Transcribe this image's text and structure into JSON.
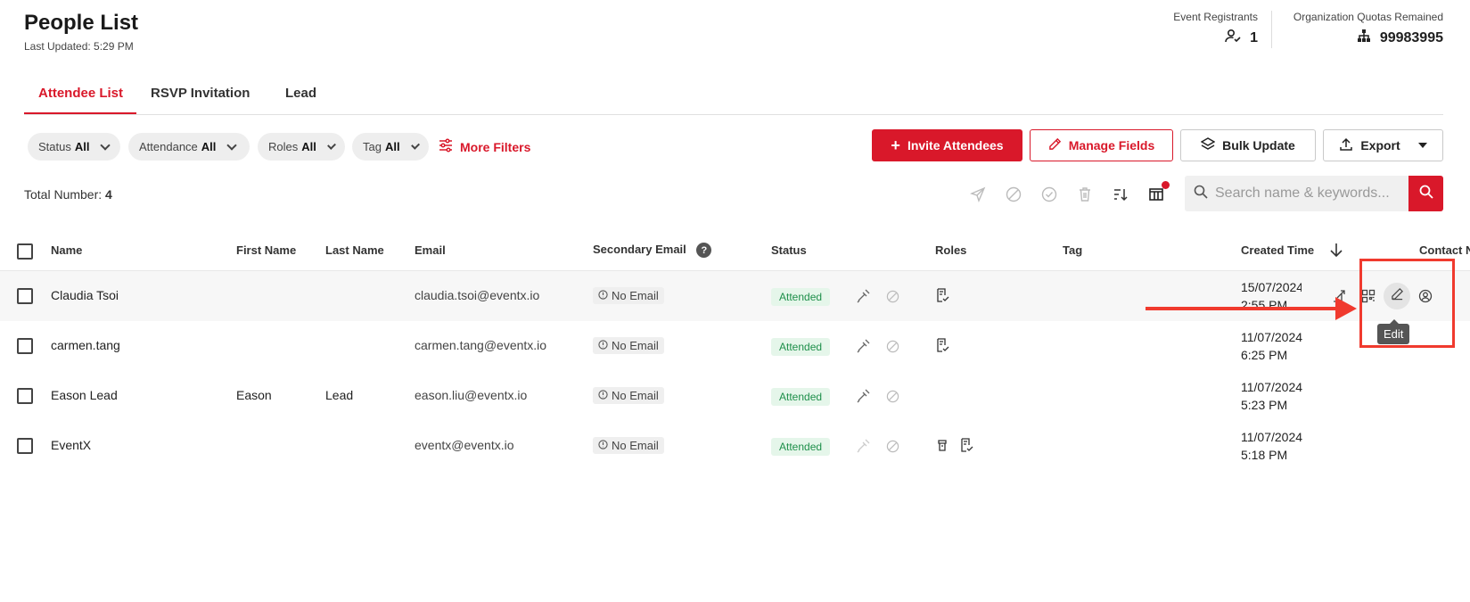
{
  "header": {
    "title": "People List",
    "last_updated": "Last Updated: 5:29 PM"
  },
  "stats": {
    "event_registrants": {
      "label": "Event Registrants",
      "value": "1"
    },
    "org_quotas": {
      "label": "Organization Quotas Remained",
      "value": "99983995"
    }
  },
  "tabs": [
    {
      "label": "Attendee List",
      "active": true
    },
    {
      "label": "RSVP Invitation",
      "active": false
    },
    {
      "label": "Lead",
      "active": false
    }
  ],
  "filters": [
    {
      "label": "Status",
      "value": "All"
    },
    {
      "label": "Attendance",
      "value": "All"
    },
    {
      "label": "Roles",
      "value": "All"
    },
    {
      "label": "Tag",
      "value": "All"
    }
  ],
  "more_filters": "More Filters",
  "actions": {
    "invite": "Invite Attendees",
    "manage_fields": "Manage Fields",
    "bulk_update": "Bulk Update",
    "export": "Export"
  },
  "total": {
    "label": "Total Number:",
    "value": "4"
  },
  "search": {
    "placeholder": "Search name & keywords..."
  },
  "columns": {
    "name": "Name",
    "first_name": "First Name",
    "last_name": "Last Name",
    "email": "Email",
    "secondary_email": "Secondary Email",
    "status": "Status",
    "roles": "Roles",
    "tag": "Tag",
    "created_time": "Created Time",
    "contact": "Contact N"
  },
  "rows": [
    {
      "name": "Claudia Tsoi",
      "first_name": "",
      "last_name": "",
      "email": "claudia.tsoi@eventx.io",
      "secondary_email": "No Email",
      "status": "Attended",
      "created_date": "15/07/2024",
      "created_time": "2:55 PM"
    },
    {
      "name": "carmen.tang",
      "first_name": "",
      "last_name": "",
      "email": "carmen.tang@eventx.io",
      "secondary_email": "No Email",
      "status": "Attended",
      "created_date": "11/07/2024",
      "created_time": "6:25 PM"
    },
    {
      "name": "Eason Lead",
      "first_name": "Eason",
      "last_name": "Lead",
      "email": "eason.liu@eventx.io",
      "secondary_email": "No Email",
      "status": "Attended",
      "created_date": "11/07/2024",
      "created_time": "5:23 PM"
    },
    {
      "name": "EventX",
      "first_name": "",
      "last_name": "",
      "email": "eventx@eventx.io",
      "secondary_email": "No Email",
      "status": "Attended",
      "created_date": "11/07/2024",
      "created_time": "5:18 PM"
    }
  ],
  "tooltip": "Edit",
  "colors": {
    "accent": "#d9182a",
    "status_green": "#1e8f4a",
    "annotation": "#f03a2e"
  }
}
